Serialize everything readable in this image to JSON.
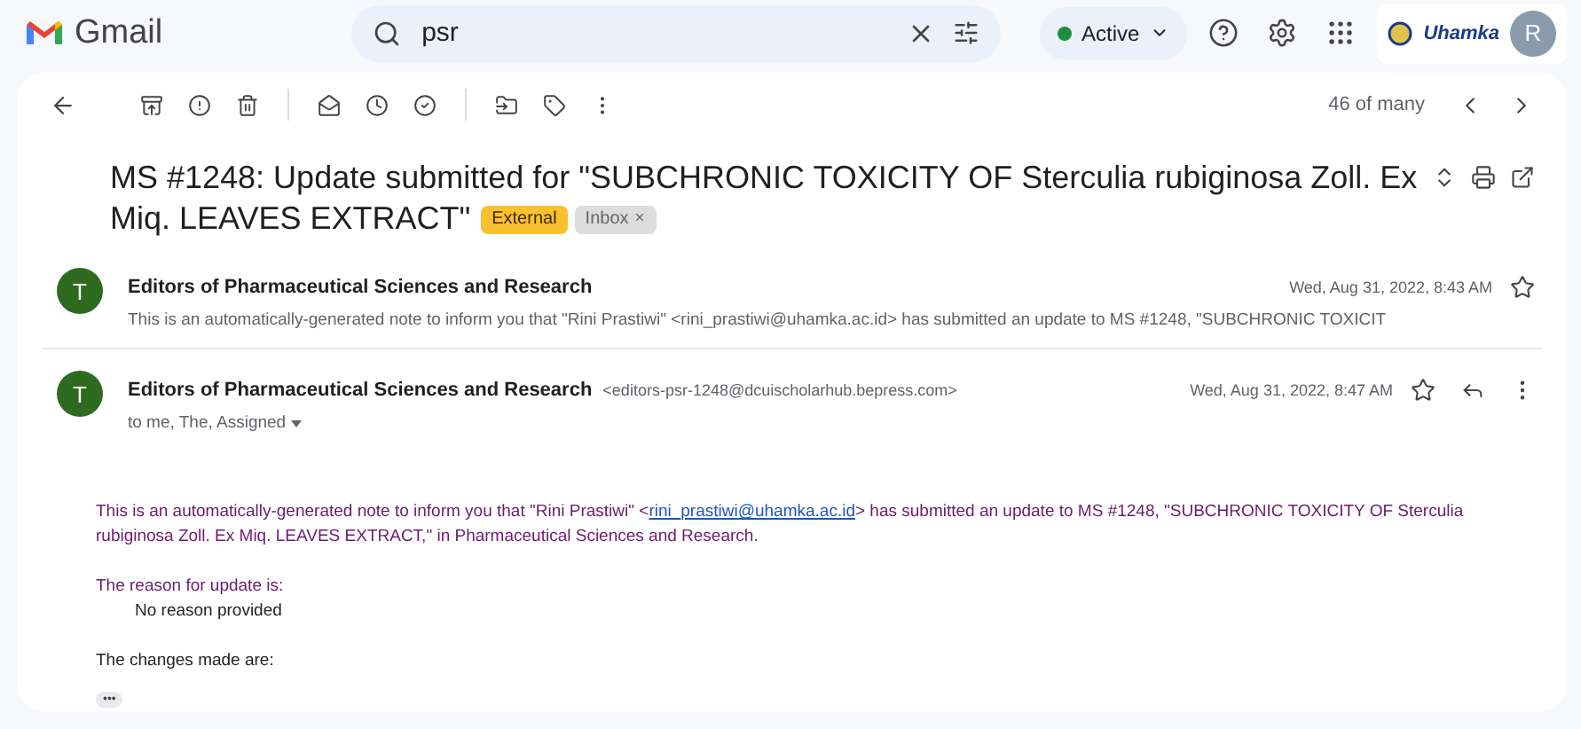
{
  "app": {
    "name": "Gmail"
  },
  "search": {
    "value": "psr"
  },
  "status": {
    "label": "Active",
    "color": "#1e8e3e"
  },
  "org_logo": {
    "text": "Uhamka"
  },
  "account": {
    "initial": "R"
  },
  "pager": {
    "text": "46 of many"
  },
  "subject": {
    "title": "MS #1248: Update submitted for \"SUBCHRONIC TOXICITY OF Sterculia rubiginosa Zoll. Ex Miq. LEAVES EXTRACT\"",
    "labels": [
      {
        "text": "External",
        "kind": "external"
      },
      {
        "text": "Inbox",
        "kind": "removable"
      }
    ]
  },
  "messages": [
    {
      "initial": "T",
      "sender": "Editors of Pharmaceutical Sciences and Research",
      "date": "Wed, Aug 31, 2022, 8:43 AM",
      "expanded": false,
      "snippet": "This is an automatically-generated note to inform you that \"Rini Prastiwi\" <rini_prastiwi@uhamka.ac.id> has submitted an update to MS #1248, \"SUBCHRONIC TOXICIT"
    },
    {
      "initial": "T",
      "sender": "Editors of Pharmaceutical Sciences and Research",
      "address": "<editors-psr-1248@dcuischolarhub.bepress.com>",
      "date": "Wed, Aug 31, 2022, 8:47 AM",
      "expanded": true,
      "recipients": "to me, The, Assigned",
      "body": {
        "intro_before": "This is an automatically-generated note to inform you that \"Rini Prastiwi\" <",
        "link": "rini_prastiwi@uhamka.ac.id",
        "intro_after": "> has submitted an update to MS #1248, \"SUBCHRONIC TOXICITY OF Sterculia rubiginosa Zoll. Ex Miq. LEAVES EXTRACT,\" in Pharmaceutical Sciences and Research.",
        "reason_heading": "The reason for update is:",
        "reason": "No reason provided",
        "changes_heading": "The changes made are:",
        "more": "•••"
      }
    }
  ]
}
